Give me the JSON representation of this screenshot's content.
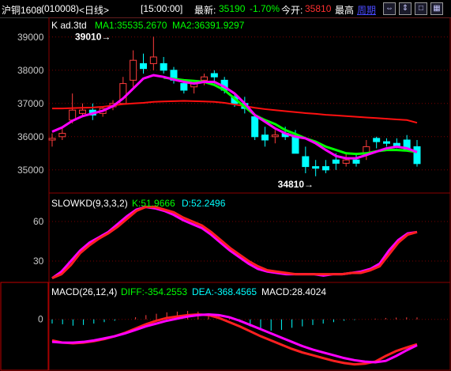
{
  "topbar": {
    "symbol": "沪铜1608",
    "code": "(010008)",
    "period": "<日线>",
    "time": "[15:00:00]",
    "latest_label": "最新:",
    "latest_value": "35190",
    "change_pct": "-1.70%",
    "open_label": "今开:",
    "open_value": "35810",
    "high_label": "最高",
    "weekly_label": "周期",
    "icons": [
      "arrows-left-right-icon",
      "arrows-up-down-icon",
      "square-icon",
      "grid-icon"
    ]
  },
  "colors": {
    "up": "#ff3c3c",
    "down": "#00ffff",
    "ma1": "#ff00ff",
    "ma2": "#00ff00",
    "kline_d": "#ff2020",
    "kd_k": "#ff00ff",
    "kd_d": "#00ffff",
    "grid": "#7a0000",
    "latest": "#00ff00",
    "open": "#ff3030",
    "link": "#4040ff"
  },
  "chart_data": [
    {
      "type": "candlestick",
      "title": "K  ad.3td",
      "ma1_label": "MA1:35535.2670",
      "ma2_label": "MA2:36391.9297",
      "yticks": [
        35000,
        36000,
        37000,
        38000,
        39000
      ],
      "ylim": [
        34400,
        39400
      ],
      "annotations": [
        {
          "text": "39010",
          "index": 6,
          "value": 39010
        },
        {
          "text": "34810",
          "index": 26,
          "value": 34810
        }
      ],
      "candles": [
        [
          35900,
          36100,
          35700,
          35950
        ],
        [
          36000,
          36300,
          35900,
          36100
        ],
        [
          36500,
          37300,
          36400,
          36800
        ],
        [
          36700,
          37000,
          36600,
          36800
        ],
        [
          36800,
          37000,
          36500,
          36650
        ],
        [
          36700,
          36900,
          36600,
          36850
        ],
        [
          36900,
          37100,
          36800,
          37000
        ],
        [
          37000,
          37800,
          37000,
          37600
        ],
        [
          37700,
          38600,
          37500,
          38300
        ],
        [
          38200,
          38500,
          37900,
          38050
        ],
        [
          38200,
          39010,
          38000,
          38400
        ],
        [
          38200,
          38400,
          37900,
          38000
        ],
        [
          38000,
          38100,
          37600,
          37700
        ],
        [
          37600,
          37700,
          37300,
          37400
        ],
        [
          37500,
          37700,
          37300,
          37600
        ],
        [
          37700,
          37900,
          37550,
          37800
        ],
        [
          37900,
          38000,
          37600,
          37800
        ],
        [
          37700,
          37800,
          37300,
          37400
        ],
        [
          37200,
          37300,
          36900,
          37000
        ],
        [
          37000,
          37200,
          36700,
          36850
        ],
        [
          36600,
          36700,
          35900,
          36000
        ],
        [
          36050,
          36300,
          35700,
          35900
        ],
        [
          36000,
          36200,
          35800,
          36050
        ],
        [
          36100,
          36300,
          35900,
          36000
        ],
        [
          36000,
          36200,
          35500,
          35500
        ],
        [
          35400,
          35700,
          34900,
          35100
        ],
        [
          35100,
          35300,
          34810,
          35050
        ],
        [
          35100,
          35300,
          34900,
          35000
        ],
        [
          35300,
          35500,
          35000,
          35200
        ],
        [
          35200,
          35500,
          35100,
          35300
        ],
        [
          35300,
          35500,
          35100,
          35200
        ],
        [
          35500,
          35900,
          35300,
          35700
        ],
        [
          35950,
          36000,
          35650,
          35850
        ],
        [
          35850,
          35950,
          35700,
          35800
        ],
        [
          35800,
          35950,
          35650,
          35700
        ],
        [
          35900,
          36050,
          35600,
          35600
        ],
        [
          35700,
          35900,
          35100,
          35190
        ]
      ],
      "ma1": [
        36150,
        36280,
        36480,
        36620,
        36700,
        36780,
        36920,
        37150,
        37450,
        37750,
        37850,
        37800,
        37720,
        37650,
        37600,
        37650,
        37650,
        37500,
        37300,
        37000,
        36650,
        36450,
        36250,
        36100,
        36000,
        35950,
        35800,
        35600,
        35420,
        35350,
        35350,
        35450,
        35550,
        35650,
        35700,
        35650,
        35535
      ],
      "ma2": [
        null,
        null,
        null,
        null,
        null,
        null,
        null,
        null,
        null,
        null,
        null,
        37780,
        37740,
        37700,
        37680,
        37650,
        37560,
        37400,
        37150,
        36900,
        36650,
        36500,
        36380,
        36200,
        36080,
        35950,
        35850,
        35700,
        35600,
        35500,
        35480,
        35500,
        35560,
        35600,
        35600,
        35580,
        35540
      ],
      "ma_slow": [
        36850,
        36850,
        36860,
        36870,
        36880,
        36900,
        36940,
        36980,
        37000,
        37020,
        37050,
        37060,
        37070,
        37080,
        37070,
        37060,
        37050,
        37020,
        36970,
        36920,
        36870,
        36830,
        36800,
        36770,
        36740,
        36710,
        36690,
        36660,
        36640,
        36620,
        36600,
        36580,
        36560,
        36540,
        36520,
        36500,
        36420
      ]
    },
    {
      "type": "line",
      "title": "SLOWKD(9,3,3,2)",
      "k_label": "K:51.9666",
      "d_label": "D:52.2496",
      "yticks": [
        30,
        60
      ],
      "ylim": [
        15,
        78
      ],
      "series": [
        {
          "name": "K",
          "values": [
            17,
            22,
            30,
            38,
            44,
            48,
            52,
            58,
            64,
            69,
            71,
            70,
            68,
            65,
            61,
            58,
            55,
            50,
            44,
            38,
            33,
            28,
            24,
            22,
            21,
            20,
            20,
            20,
            20,
            19,
            20,
            20,
            21,
            22,
            24,
            28,
            38,
            46,
            51,
            52
          ]
        },
        {
          "name": "D",
          "values": [
            17,
            20,
            27,
            36,
            42,
            47,
            51,
            56,
            62,
            68,
            71,
            71,
            69,
            67,
            63,
            60,
            57,
            52,
            46,
            40,
            35,
            30,
            26,
            23,
            22,
            21,
            20,
            20,
            20,
            20,
            20,
            20,
            21,
            21,
            23,
            26,
            35,
            44,
            50,
            52
          ]
        }
      ]
    },
    {
      "type": "bar",
      "title": "MACD(26,12,4)",
      "diff_label": "DIFF:-354.2553",
      "dea_label": "DEA:-368.4565",
      "macd_label": "MACD:28.4024",
      "yticks": [
        0
      ],
      "ylim": [
        -700,
        300
      ],
      "macd": [
        -60,
        -70,
        -90,
        -80,
        -60,
        -40,
        -20,
        0,
        30,
        60,
        80,
        100,
        110,
        120,
        110,
        80,
        50,
        10,
        -40,
        -100,
        -140,
        -160,
        -150,
        -120,
        -100,
        -80,
        -60,
        -40,
        -20,
        -10,
        0,
        10,
        20,
        25,
        28,
        28
      ],
      "series": [
        {
          "name": "DIFF",
          "values": [
            -300,
            -330,
            -340,
            -330,
            -310,
            -280,
            -240,
            -190,
            -130,
            -70,
            -20,
            20,
            40,
            60,
            70,
            60,
            20,
            -40,
            -100,
            -170,
            -240,
            -300,
            -360,
            -420,
            -470,
            -510,
            -550,
            -590,
            -620,
            -640,
            -630,
            -600,
            -520,
            -450,
            -400,
            -354
          ]
        },
        {
          "name": "DEA",
          "values": [
            -320,
            -330,
            -330,
            -320,
            -300,
            -270,
            -240,
            -200,
            -150,
            -100,
            -60,
            -20,
            10,
            40,
            60,
            70,
            60,
            30,
            -20,
            -80,
            -140,
            -200,
            -260,
            -320,
            -380,
            -430,
            -470,
            -510,
            -550,
            -580,
            -600,
            -610,
            -590,
            -520,
            -440,
            -368
          ]
        }
      ]
    }
  ]
}
